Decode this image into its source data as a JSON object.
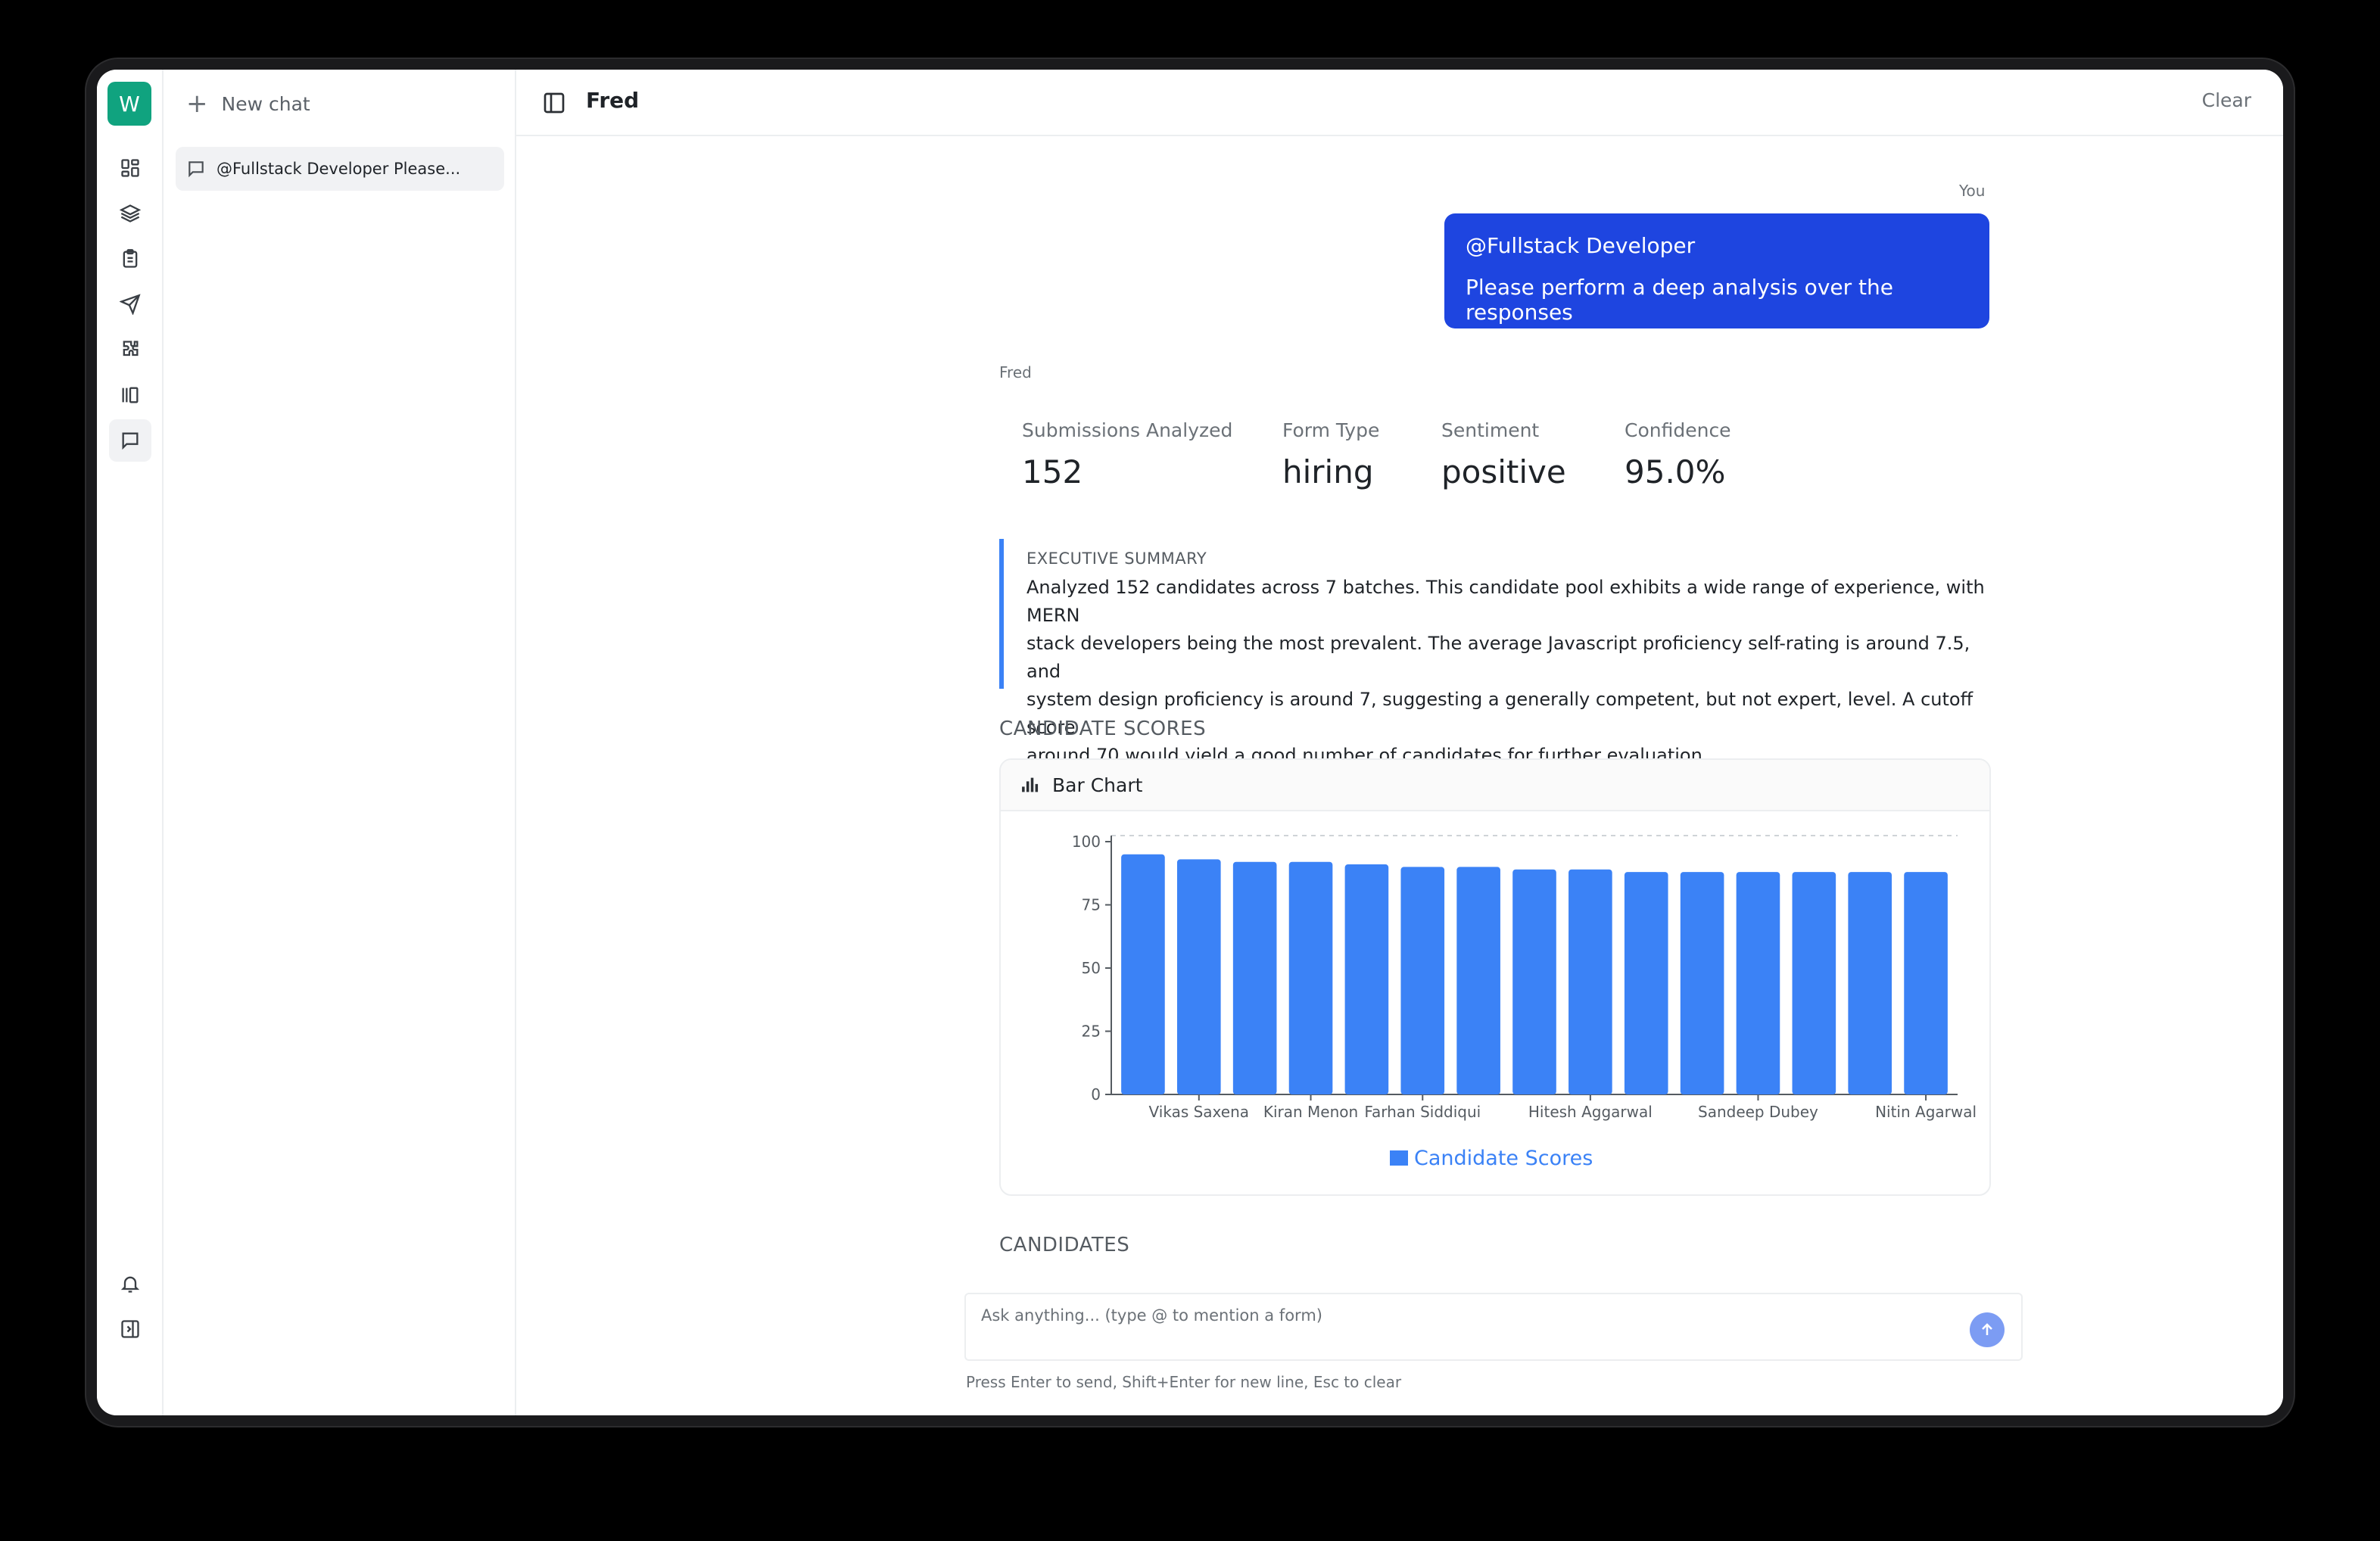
{
  "app": {
    "logo_letter": "W",
    "brand_color": "#10a37f",
    "accent_color": "#1e45e0"
  },
  "rail": {
    "items": [
      "dashboard-icon",
      "layers-icon",
      "clipboard-icon",
      "send-icon",
      "puzzle-icon",
      "library-icon",
      "chat-icon"
    ],
    "bottom": [
      "bell-icon",
      "collapse-sidebar-icon"
    ],
    "active": "chat-icon"
  },
  "sidebar": {
    "new_chat_label": "New chat",
    "conversations": [
      {
        "title": "@Fullstack Developer Please..."
      }
    ]
  },
  "header": {
    "title": "Fred",
    "clear_label": "Clear"
  },
  "user_message": {
    "author": "You",
    "lines": [
      "@Fullstack Developer",
      "Please perform a deep analysis over the responses"
    ]
  },
  "assistant": {
    "author": "Fred",
    "stats": [
      {
        "label": "Submissions Analyzed",
        "value": "152"
      },
      {
        "label": "Form Type",
        "value": "hiring"
      },
      {
        "label": "Sentiment",
        "value": "positive"
      },
      {
        "label": "Confidence",
        "value": "95.0%"
      }
    ],
    "summary_heading": "EXECUTIVE SUMMARY",
    "summary_lines": [
      "Analyzed 152 candidates across 7 batches. This candidate pool exhibits a wide range of experience, with MERN",
      "stack developers being the most prevalent. The average Javascript proficiency self-rating is around 7.5, and",
      "system design proficiency is around 7, suggesting a generally competent, but not expert, level. A cutoff score",
      "around 70 would yield a good number of candidates for further evaluation."
    ],
    "scores_heading": "CANDIDATE SCORES",
    "chart_card_title": "Bar Chart",
    "candidates_heading": "CANDIDATES"
  },
  "chart_data": {
    "type": "bar",
    "categories": [
      "",
      "Vikas Saxena",
      "",
      "Kiran Menon",
      "",
      "Farhan Siddiqui",
      "",
      "",
      "Hitesh Aggarwal",
      "",
      "",
      "Sandeep Dubey",
      "",
      "",
      "Nitin Agarwal"
    ],
    "series": [
      {
        "name": "Candidate Scores",
        "color": "#3b82f6",
        "values": [
          95,
          93,
          92,
          92,
          91,
          90,
          90,
          89,
          89,
          88,
          88,
          88,
          88,
          88,
          88
        ]
      }
    ],
    "ylim": [
      0,
      100
    ],
    "yticks": [
      0,
      25,
      50,
      75,
      100
    ],
    "grid": true,
    "legend": "bottom"
  },
  "composer": {
    "placeholder": "Ask anything... (type @ to mention a form)",
    "hint": "Press Enter to send, Shift+Enter for new line, Esc to clear"
  }
}
